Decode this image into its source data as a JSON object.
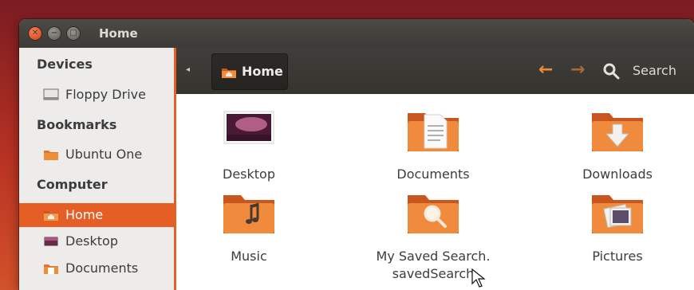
{
  "window": {
    "title": "Home"
  },
  "sidebar": {
    "sections": [
      {
        "heading": "Devices",
        "items": [
          {
            "label": "Floppy Drive",
            "icon": "floppy-drive-icon"
          }
        ]
      },
      {
        "heading": "Bookmarks",
        "items": [
          {
            "label": "Ubuntu One",
            "icon": "folder-icon"
          }
        ]
      },
      {
        "heading": "Computer",
        "items": [
          {
            "label": "Home",
            "icon": "home-folder-icon",
            "active": true
          },
          {
            "label": "Desktop",
            "icon": "desktop-icon"
          },
          {
            "label": "Documents",
            "icon": "documents-icon"
          }
        ]
      }
    ]
  },
  "toolbar": {
    "breadcrumb_label": "Home",
    "search_label": "Search"
  },
  "content": {
    "items": [
      {
        "label": "Desktop",
        "icon": "desktop-folder-icon"
      },
      {
        "label": "Documents",
        "icon": "documents-folder-icon"
      },
      {
        "label": "Downloads",
        "icon": "downloads-folder-icon"
      },
      {
        "label": "Music",
        "icon": "music-folder-icon"
      },
      {
        "label": "My Saved Search. savedSearch",
        "icon": "saved-search-folder-icon"
      },
      {
        "label": "Pictures",
        "icon": "pictures-folder-icon"
      }
    ]
  },
  "colors": {
    "accent": "#e45e25",
    "titlebar": "#3c3b37",
    "sidebar": "#edeceb",
    "content": "#ffffff"
  }
}
